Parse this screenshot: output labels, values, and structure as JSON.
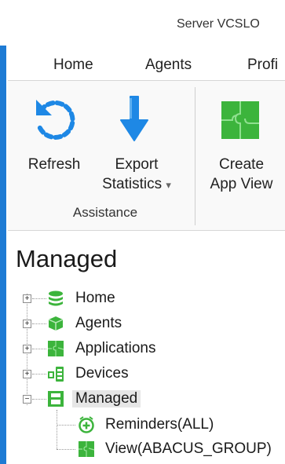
{
  "window": {
    "title": "Server VCSLO"
  },
  "menu": {
    "tabs": [
      "Home",
      "Agents",
      "Profi"
    ]
  },
  "ribbon": {
    "refresh_label": "Refresh",
    "export_label_line1": "Export",
    "export_label_line2": "Statistics",
    "export_dropdown_glyph": "▾",
    "group_label": "Assistance",
    "create_label_line1": "Create",
    "create_label_line2": "App View"
  },
  "section": {
    "title": "Managed"
  },
  "tree": {
    "items": [
      {
        "label": "Home",
        "icon": "database-icon",
        "expander": "+"
      },
      {
        "label": "Agents",
        "icon": "cube-icon",
        "expander": "+"
      },
      {
        "label": "Applications",
        "icon": "puzzle-icon",
        "expander": "+"
      },
      {
        "label": "Devices",
        "icon": "devices-icon",
        "expander": "+"
      },
      {
        "label": "Managed",
        "icon": "managed-icon",
        "expander": "−",
        "selected": true
      },
      {
        "label": "Reminders(ALL)",
        "icon": "reminder-icon",
        "child": true
      },
      {
        "label": "View(ABACUS_GROUP)",
        "icon": "puzzle-icon",
        "child": true
      }
    ]
  },
  "colors": {
    "accent_blue": "#1e88e5",
    "green": "#3cb43c",
    "frame_blue": "#1e7bd4"
  }
}
